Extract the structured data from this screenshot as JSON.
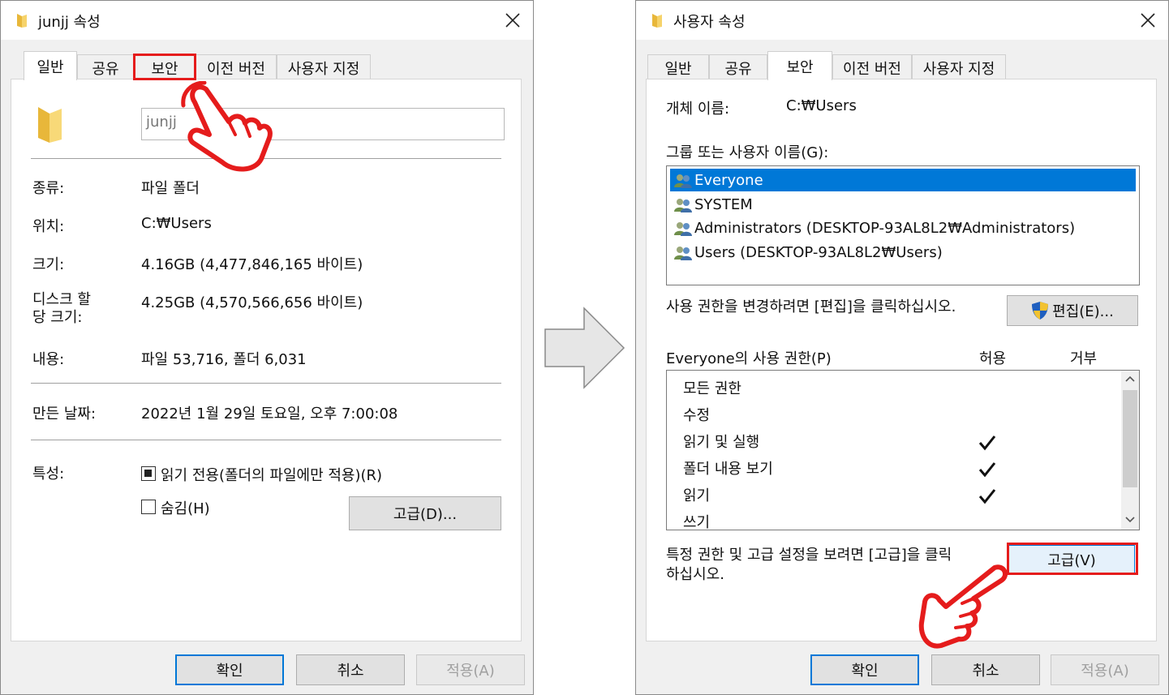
{
  "left_dialog": {
    "title": "junjj 속성",
    "tabs": [
      "일반",
      "공유",
      "보안",
      "이전 버전",
      "사용자 지정"
    ],
    "folder_name": "junjj",
    "props": [
      {
        "label": "종류:",
        "value": "파일 폴더"
      },
      {
        "label": "위치:",
        "value": "C:₩Users"
      },
      {
        "label": "크기:",
        "value": "4.16GB (4,477,846,165 바이트)"
      },
      {
        "label": "디스크 할\n당 크기:",
        "value": "4.25GB (4,570,566,656 바이트)"
      },
      {
        "label": "내용:",
        "value": "파일 53,716, 폴더 6,031"
      },
      {
        "label": "만든 날짜:",
        "value": "2022년 1월 29일 토요일, 오후 7:00:08"
      }
    ],
    "attributes_label": "특성:",
    "readonly_label": "읽기 전용(폴더의 파일에만 적용)(R)",
    "hidden_label": "숨김(H)",
    "advanced_button": "고급(D)...",
    "ok": "확인",
    "cancel": "취소",
    "apply": "적용(A)"
  },
  "right_dialog": {
    "title": "사용자 속성",
    "tabs": [
      "일반",
      "공유",
      "보안",
      "이전 버전",
      "사용자 지정"
    ],
    "object_name_label": "개체 이름:",
    "object_name_value": "C:₩Users",
    "groups_label": "그룹 또는 사용자 이름(G):",
    "groups": [
      "Everyone",
      "SYSTEM",
      "Administrators (DESKTOP-93AL8L2₩Administrators)",
      "Users (DESKTOP-93AL8L2₩Users)"
    ],
    "edit_hint": "사용 권한을 변경하려면 [편집]을 클릭하십시오.",
    "edit_button": "편집(E)...",
    "perm_header": "Everyone의 사용 권한(P)",
    "allow_header": "허용",
    "deny_header": "거부",
    "permissions": [
      {
        "name": "모든 권한",
        "allow": false
      },
      {
        "name": "수정",
        "allow": false
      },
      {
        "name": "읽기 및 실행",
        "allow": true
      },
      {
        "name": "폴더 내용 보기",
        "allow": true
      },
      {
        "name": "읽기",
        "allow": true
      },
      {
        "name": "쓰기",
        "allow": false
      }
    ],
    "advanced_hint_line1": "특정 권한 및 고급 설정을 보려면 [고급]을 클릭",
    "advanced_hint_line2": "하십시오.",
    "advanced_button": "고급(V)",
    "ok": "확인",
    "cancel": "취소",
    "apply": "적용(A)"
  },
  "colors": {
    "highlight": "#e51c1c",
    "selection": "#0078d7",
    "folder": "#f2c94c"
  }
}
